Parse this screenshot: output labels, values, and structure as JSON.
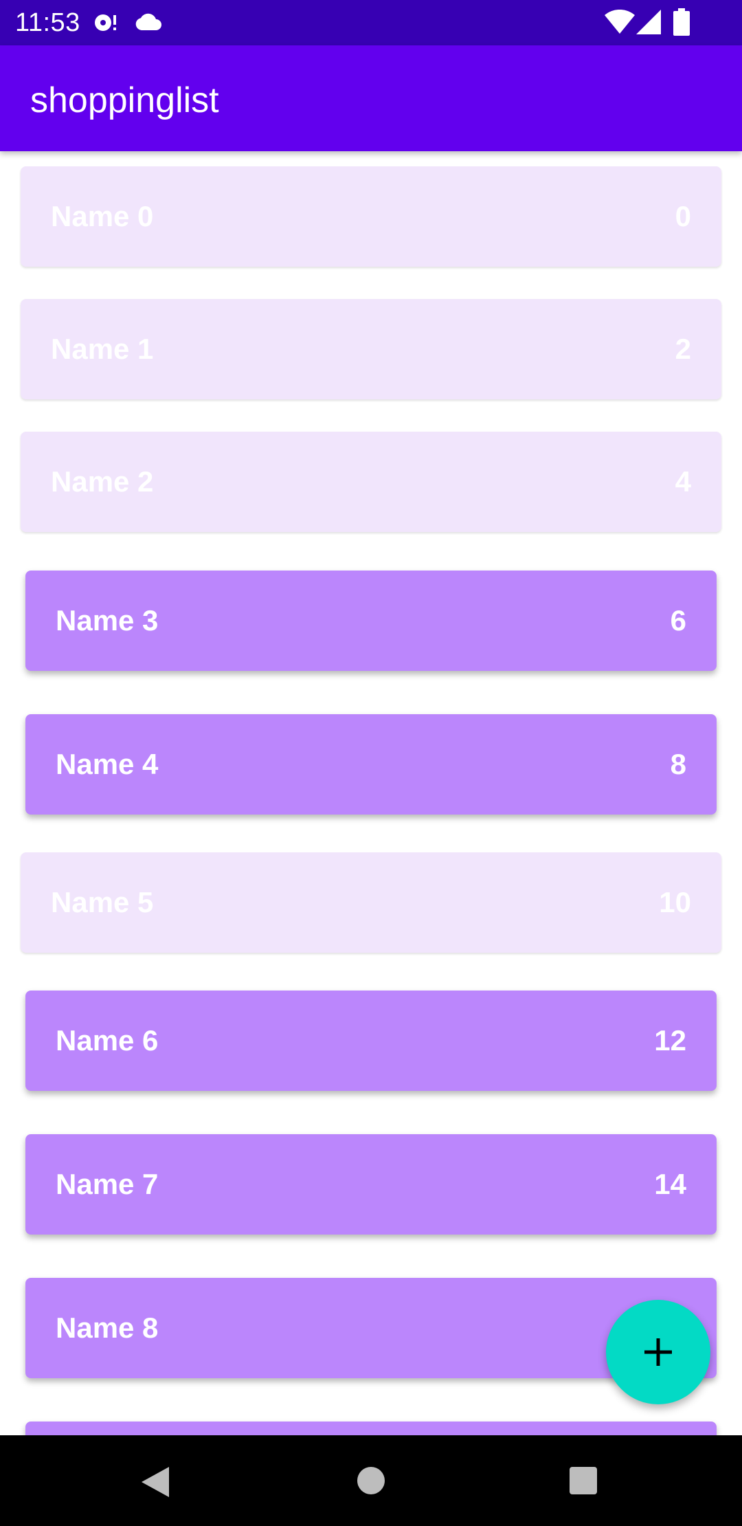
{
  "status_bar": {
    "time": "11:53",
    "background": "#3700B3",
    "left_icons": [
      "sync-disc-icon",
      "cloud-icon"
    ],
    "right_icons": [
      "wifi-icon",
      "cell-signal-icon",
      "battery-icon"
    ]
  },
  "app_bar": {
    "title": "shoppinglist",
    "background": "#6200EE"
  },
  "colors": {
    "card_light": "#F1E5FC",
    "card_dark": "#BB86FC",
    "fab": "#03DAC5",
    "nav_bar": "#000000"
  },
  "list": {
    "items": [
      {
        "name": "Name 0",
        "quantity": "0",
        "style": "light"
      },
      {
        "name": "Name 1",
        "quantity": "2",
        "style": "light"
      },
      {
        "name": "Name 2",
        "quantity": "4",
        "style": "light"
      },
      {
        "name": "Name 3",
        "quantity": "6",
        "style": "dark"
      },
      {
        "name": "Name 4",
        "quantity": "8",
        "style": "dark"
      },
      {
        "name": "Name 5",
        "quantity": "10",
        "style": "light"
      },
      {
        "name": "Name 6",
        "quantity": "12",
        "style": "dark"
      },
      {
        "name": "Name 7",
        "quantity": "14",
        "style": "dark"
      },
      {
        "name": "Name 8",
        "quantity": "",
        "style": "dark"
      },
      {
        "name": "",
        "quantity": "",
        "style": "dark"
      }
    ]
  },
  "fab": {
    "icon": "plus-icon"
  },
  "nav_bar": {
    "buttons": [
      "back-icon",
      "home-icon",
      "recents-icon"
    ]
  }
}
